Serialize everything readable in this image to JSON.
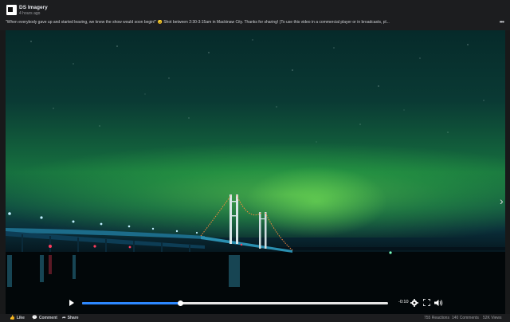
{
  "post": {
    "page_name": "DS Imagery",
    "time": "4 hours ago",
    "caption": "\"When everybody gave up and started leaving, we knew the show would soon begin!\" 😉 Shot between 2:30-3:15am in Mackinaw City. Thanks for sharing! (To use this video in a commercial player or in broadcasts, pl..."
  },
  "icons": {
    "more": "more-options-icon",
    "next": "chevron-right-icon",
    "play": "play-icon",
    "settings": "gear-icon",
    "fullscreen": "fullscreen-icon",
    "volume": "volume-icon",
    "like": "like-icon",
    "comment": "comment-icon",
    "share": "share-icon"
  },
  "player": {
    "time_remaining": "-0:10",
    "progress": 0.32
  },
  "footer": {
    "like_label": "Like",
    "comment_label": "Comment",
    "share_label": "Share",
    "reactions": "755 Reactions",
    "comments": "140 Comments",
    "views": "52K Views"
  },
  "colors": {
    "accent": "#2d88ff",
    "background": "#18191a",
    "aurora": "#5fd35a"
  }
}
